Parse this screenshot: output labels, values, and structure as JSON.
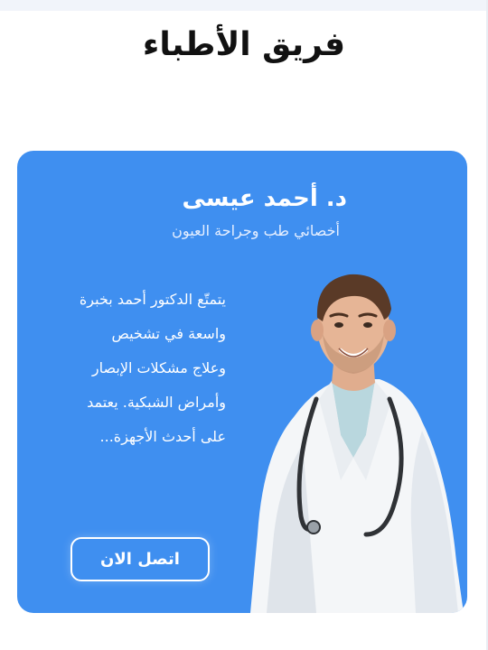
{
  "section": {
    "title": "فريق الأطباء"
  },
  "doctor": {
    "name": "د. أحمد عيسى",
    "specialty": "أخصائي طب وجراحة العيون",
    "bio_lines": [
      "يتمتّع الدكتور أحمد بخبرة",
      "واسعة في تشخيص",
      "وعلاج مشكلات الإبصار",
      "وأمراض الشبكية. يعتمد",
      "على أحدث الأجهزة..."
    ],
    "contact_label": "اتصل الان",
    "photo_icon": "doctor-portrait"
  },
  "colors": {
    "card_background": "#3f8ff0",
    "title_text": "#111111",
    "card_text": "#ffffff"
  }
}
